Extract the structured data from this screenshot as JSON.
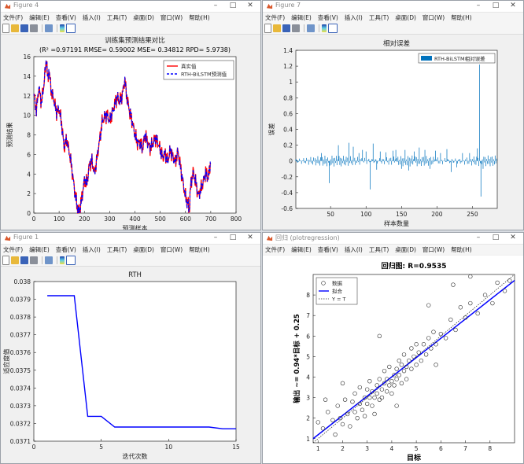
{
  "windows": [
    {
      "title": "Figure 4",
      "menu": [
        "文件(F)",
        "编辑(E)",
        "查看(V)",
        "插入(I)",
        "工具(T)",
        "桌面(D)",
        "窗口(W)",
        "帮助(H)"
      ],
      "chart_title": "训练集预测结果对比",
      "chart_subtitle": "(R² =0.97191 RMSE= 0.59002 MSE= 0.34812 RPD= 5.9738)",
      "xlabel": "预测样本",
      "ylabel": "预测结果",
      "legend": [
        "真实值",
        "RTH-BiLSTM预测值"
      ]
    },
    {
      "title": "Figure 7",
      "menu": [
        "文件(F)",
        "编辑(E)",
        "查看(V)",
        "插入(I)",
        "工具(T)",
        "桌面(D)",
        "窗口(W)",
        "帮助(H)"
      ],
      "chart_title": "相对误差",
      "xlabel": "样本数量",
      "ylabel": "误差",
      "legend": [
        "RTH-BiLSTM相对误差"
      ]
    },
    {
      "title": "Figure 1",
      "menu": [
        "文件(F)",
        "编辑(E)",
        "查看(V)",
        "插入(I)",
        "工具(T)",
        "桌面(D)",
        "窗口(W)",
        "帮助(H)"
      ],
      "chart_title": "RTH",
      "xlabel": "迭代次数",
      "ylabel": "适应度值"
    },
    {
      "title": "回归 (plotregression)",
      "menu": [
        "文件(F)",
        "编辑(E)",
        "查看(V)",
        "插入(I)",
        "工具(T)",
        "桌面(D)",
        "窗口(W)",
        "帮助(H)"
      ],
      "chart_title": "回归图: R=0.9535",
      "xlabel": "目标",
      "ylabel": "输出 ~= 0.94*目标 + 0.25",
      "legend": [
        "数据",
        "拟合",
        "Y = T"
      ]
    }
  ],
  "colors": {
    "red": "#ff0000",
    "blue": "#0000ff",
    "bar": "#0072bd",
    "line": "#0000ff",
    "fit": "#0000ff"
  },
  "chart_data": [
    {
      "type": "line",
      "title": "训练集预测结果对比",
      "xlim": [
        0,
        800
      ],
      "ylim": [
        0,
        16
      ],
      "xticks": [
        0,
        100,
        200,
        300,
        400,
        500,
        600,
        700,
        800
      ],
      "yticks": [
        0,
        2,
        4,
        6,
        8,
        10,
        12,
        14,
        16
      ],
      "series_names": [
        "真实值",
        "RTH-BiLSTM预测值"
      ],
      "keypoints": [
        [
          0,
          12.2
        ],
        [
          10,
          10.5
        ],
        [
          20,
          12.8
        ],
        [
          30,
          11.3
        ],
        [
          40,
          13.2
        ],
        [
          50,
          15.8
        ],
        [
          55,
          13.6
        ],
        [
          60,
          14.6
        ],
        [
          70,
          12.3
        ],
        [
          80,
          11.5
        ],
        [
          90,
          10.3
        ],
        [
          100,
          10.6
        ],
        [
          110,
          9.2
        ],
        [
          120,
          6.6
        ],
        [
          130,
          7.6
        ],
        [
          140,
          6.3
        ],
        [
          150,
          4.6
        ],
        [
          160,
          2.6
        ],
        [
          170,
          0.9
        ],
        [
          175,
          0.3
        ],
        [
          180,
          0.1
        ],
        [
          190,
          1.6
        ],
        [
          200,
          3.3
        ],
        [
          210,
          3.1
        ],
        [
          220,
          5.0
        ],
        [
          230,
          5.3
        ],
        [
          240,
          4.1
        ],
        [
          250,
          5.6
        ],
        [
          260,
          7.4
        ],
        [
          270,
          9.3
        ],
        [
          280,
          9.8
        ],
        [
          290,
          10.1
        ],
        [
          300,
          9.4
        ],
        [
          310,
          10.2
        ],
        [
          320,
          11.2
        ],
        [
          330,
          11.8
        ],
        [
          340,
          11.4
        ],
        [
          350,
          12.1
        ],
        [
          360,
          13.6
        ],
        [
          365,
          12.4
        ],
        [
          370,
          11.7
        ],
        [
          380,
          10.2
        ],
        [
          390,
          9.3
        ],
        [
          400,
          8.1
        ],
        [
          410,
          7.1
        ],
        [
          420,
          7.3
        ],
        [
          430,
          6.5
        ],
        [
          440,
          8.0
        ],
        [
          450,
          7.3
        ],
        [
          460,
          6.6
        ],
        [
          470,
          7.1
        ],
        [
          480,
          7.7
        ],
        [
          490,
          7.2
        ],
        [
          500,
          6.6
        ],
        [
          510,
          5.6
        ],
        [
          520,
          6.1
        ],
        [
          530,
          5.3
        ],
        [
          540,
          6.4
        ],
        [
          550,
          5.8
        ],
        [
          560,
          5.2
        ],
        [
          570,
          6.3
        ],
        [
          580,
          4.8
        ],
        [
          590,
          3.1
        ],
        [
          600,
          1.7
        ],
        [
          610,
          0.9
        ],
        [
          615,
          0.3
        ],
        [
          620,
          2.6
        ],
        [
          630,
          4.3
        ],
        [
          640,
          3.2
        ],
        [
          650,
          1.8
        ],
        [
          660,
          2.4
        ],
        [
          670,
          3.1
        ],
        [
          680,
          4.2
        ],
        [
          690,
          3.5
        ],
        [
          695,
          4.4
        ],
        [
          700,
          5.4
        ]
      ]
    },
    {
      "type": "bar",
      "title": "相对误差",
      "xlim": [
        1,
        285
      ],
      "ylim": [
        -0.6,
        1.4
      ],
      "xticks": [
        50,
        100,
        150,
        200,
        250
      ],
      "yticks": [
        -0.6,
        -0.4,
        -0.2,
        0,
        0.2,
        0.4,
        0.6,
        0.8,
        1,
        1.2,
        1.4
      ],
      "notable_bars": [
        {
          "x": 37,
          "value": 0.1
        },
        {
          "x": 48,
          "value": -0.28
        },
        {
          "x": 61,
          "value": 0.2
        },
        {
          "x": 63,
          "value": -0.05
        },
        {
          "x": 76,
          "value": 0.23
        },
        {
          "x": 82,
          "value": 0.18
        },
        {
          "x": 90,
          "value": 0.1
        },
        {
          "x": 95,
          "value": 0.14
        },
        {
          "x": 100,
          "value": 0.12
        },
        {
          "x": 106,
          "value": -0.36
        },
        {
          "x": 110,
          "value": 0.22
        },
        {
          "x": 115,
          "value": -0.11
        },
        {
          "x": 120,
          "value": 0.12
        },
        {
          "x": 128,
          "value": 0.11
        },
        {
          "x": 138,
          "value": 0.13
        },
        {
          "x": 142,
          "value": 0.14
        },
        {
          "x": 150,
          "value": -0.1
        },
        {
          "x": 155,
          "value": 0.14
        },
        {
          "x": 160,
          "value": -0.12
        },
        {
          "x": 168,
          "value": 0.12
        },
        {
          "x": 175,
          "value": 0.17
        },
        {
          "x": 183,
          "value": 0.14
        },
        {
          "x": 190,
          "value": -0.1
        },
        {
          "x": 198,
          "value": 0.13
        },
        {
          "x": 205,
          "value": 0.1
        },
        {
          "x": 214,
          "value": 0.15
        },
        {
          "x": 220,
          "value": -0.14
        },
        {
          "x": 228,
          "value": -0.08
        },
        {
          "x": 236,
          "value": 0.1
        },
        {
          "x": 246,
          "value": 0.1
        },
        {
          "x": 257,
          "value": 0.16
        },
        {
          "x": 260,
          "value": 1.22
        },
        {
          "x": 262,
          "value": -0.45
        },
        {
          "x": 265,
          "value": -0.1
        }
      ]
    },
    {
      "type": "line",
      "title": "RTH",
      "xlim": [
        0,
        15
      ],
      "ylim": [
        0.0371,
        0.038
      ],
      "xticks": [
        0,
        5,
        10,
        15
      ],
      "yticks": [
        0.0371,
        0.0372,
        0.0373,
        0.0374,
        0.0375,
        0.0376,
        0.0377,
        0.0378,
        0.0379,
        0.038
      ],
      "x": [
        1,
        2,
        3,
        4,
        5,
        6,
        7,
        8,
        9,
        10,
        11,
        12,
        13,
        14,
        15
      ],
      "y": [
        0.03792,
        0.03792,
        0.03792,
        0.03724,
        0.03724,
        0.03718,
        0.03718,
        0.03718,
        0.03718,
        0.03718,
        0.03718,
        0.03718,
        0.03718,
        0.03717,
        0.03717
      ]
    },
    {
      "type": "scatter",
      "title": "回归图: R=0.9535",
      "xlim": [
        0.8,
        9
      ],
      "ylim": [
        0.8,
        9
      ],
      "xticks": [
        1,
        2,
        3,
        4,
        5,
        6,
        7,
        8
      ],
      "yticks": [
        1,
        2,
        3,
        4,
        5,
        6,
        7,
        8
      ],
      "fit": {
        "slope": 0.94,
        "intercept": 0.25
      },
      "points": [
        [
          1.0,
          1.8
        ],
        [
          1.2,
          1.5
        ],
        [
          1.4,
          2.3
        ],
        [
          1.6,
          1.9
        ],
        [
          1.7,
          1.2
        ],
        [
          1.8,
          2.6
        ],
        [
          1.9,
          2.0
        ],
        [
          2.0,
          1.7
        ],
        [
          2.1,
          2.9
        ],
        [
          2.2,
          2.2
        ],
        [
          2.3,
          1.6
        ],
        [
          2.4,
          2.8
        ],
        [
          2.5,
          2.3
        ],
        [
          2.5,
          3.2
        ],
        [
          2.6,
          2.0
        ],
        [
          2.7,
          2.7
        ],
        [
          2.7,
          3.5
        ],
        [
          2.8,
          2.4
        ],
        [
          2.9,
          3.0
        ],
        [
          2.9,
          2.1
        ],
        [
          3.0,
          3.4
        ],
        [
          3.0,
          2.7
        ],
        [
          3.1,
          3.0
        ],
        [
          3.1,
          3.8
        ],
        [
          3.2,
          2.6
        ],
        [
          3.2,
          3.3
        ],
        [
          3.3,
          3.0
        ],
        [
          3.3,
          2.2
        ],
        [
          3.4,
          3.6
        ],
        [
          3.4,
          3.2
        ],
        [
          3.5,
          2.9
        ],
        [
          3.5,
          3.9
        ],
        [
          3.6,
          3.4
        ],
        [
          3.6,
          3.0
        ],
        [
          3.7,
          3.7
        ],
        [
          3.7,
          4.3
        ],
        [
          3.8,
          3.3
        ],
        [
          3.8,
          3.9
        ],
        [
          3.9,
          3.6
        ],
        [
          3.9,
          4.5
        ],
        [
          4.0,
          3.8
        ],
        [
          4.0,
          3.2
        ],
        [
          4.1,
          4.1
        ],
        [
          4.1,
          3.6
        ],
        [
          4.2,
          4.4
        ],
        [
          4.2,
          3.9
        ],
        [
          4.3,
          4.8
        ],
        [
          4.3,
          4.1
        ],
        [
          4.4,
          3.7
        ],
        [
          4.4,
          4.6
        ],
        [
          4.5,
          4.3
        ],
        [
          4.5,
          5.1
        ],
        [
          4.6,
          4.5
        ],
        [
          4.6,
          3.9
        ],
        [
          4.7,
          4.8
        ],
        [
          4.8,
          4.4
        ],
        [
          4.8,
          5.4
        ],
        [
          4.9,
          5.0
        ],
        [
          5.0,
          4.6
        ],
        [
          5.0,
          5.6
        ],
        [
          5.1,
          5.2
        ],
        [
          5.2,
          4.8
        ],
        [
          5.3,
          5.6
        ],
        [
          5.4,
          5.1
        ],
        [
          5.5,
          5.9
        ],
        [
          5.6,
          5.4
        ],
        [
          5.7,
          6.2
        ],
        [
          5.8,
          5.6
        ],
        [
          6.0,
          6.1
        ],
        [
          6.2,
          5.9
        ],
        [
          6.4,
          6.8
        ],
        [
          6.6,
          6.3
        ],
        [
          6.8,
          7.4
        ],
        [
          7.0,
          6.9
        ],
        [
          7.2,
          7.6
        ],
        [
          7.5,
          7.1
        ],
        [
          7.8,
          8.0
        ],
        [
          8.1,
          7.6
        ],
        [
          8.3,
          8.6
        ],
        [
          8.6,
          8.2
        ],
        [
          8.8,
          8.7
        ],
        [
          5.5,
          7.5
        ],
        [
          6.5,
          8.5
        ],
        [
          7.2,
          8.9
        ],
        [
          3.5,
          6.0
        ],
        [
          4.2,
          2.6
        ],
        [
          5.8,
          4.6
        ],
        [
          2.0,
          3.7
        ],
        [
          1.3,
          2.9
        ]
      ]
    }
  ]
}
